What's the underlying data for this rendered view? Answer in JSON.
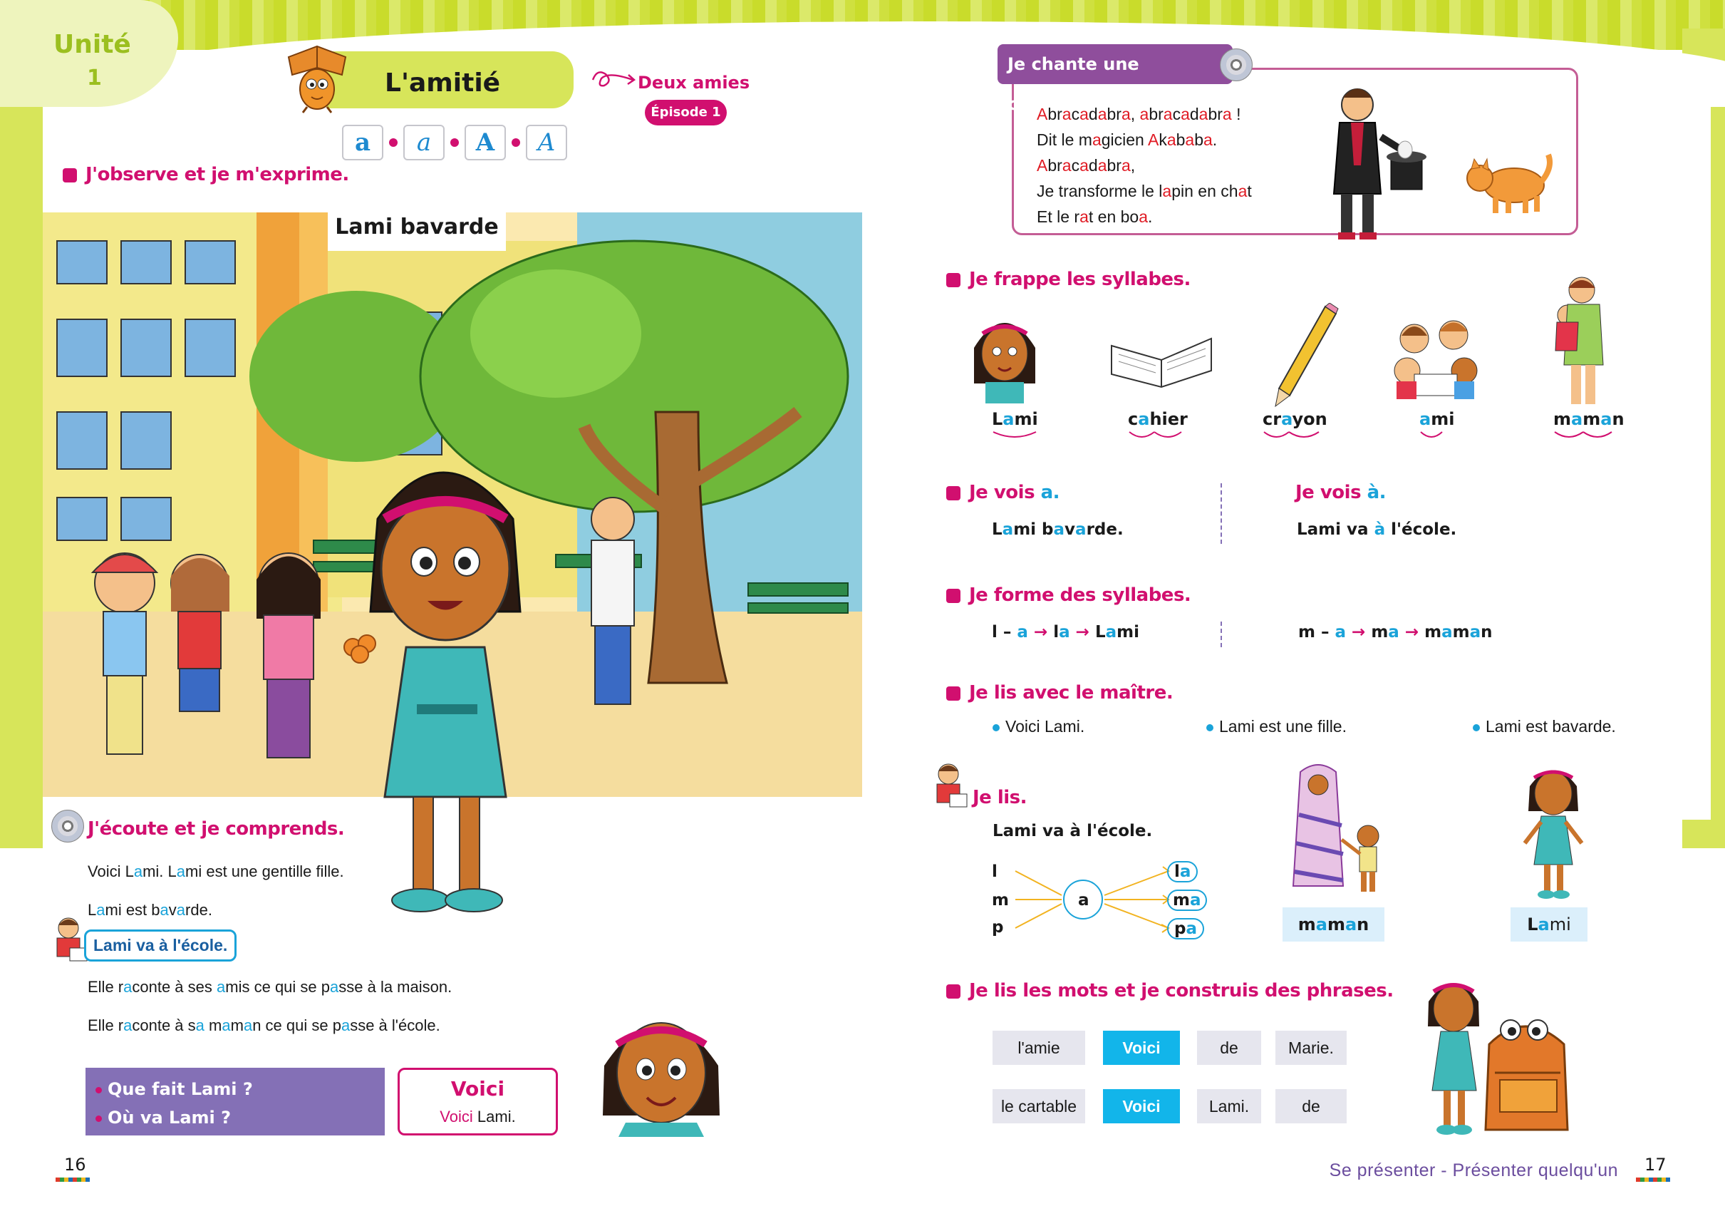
{
  "unit": {
    "label": "Unité",
    "number": "1"
  },
  "title": "L'amitié",
  "story": {
    "name": "Deux amies",
    "episode": "Épisode 1"
  },
  "letters": [
    "a",
    "a",
    "A",
    "A"
  ],
  "left_page": {
    "observe_title": "J'observe et je m'exprime.",
    "illustration_caption": "Lami bavarde",
    "listen_title": "J'écoute et je comprends.",
    "story_lines": {
      "l1": [
        "Voici L",
        "a",
        "mi. L",
        "a",
        "mi est une gentille fille."
      ],
      "l2": [
        "L",
        "a",
        "mi est b",
        "a",
        "v",
        "a",
        "rde."
      ],
      "l3": "Lami va à l'école.",
      "l4": [
        "Elle r",
        "a",
        "conte à ses ",
        "a",
        "mis ce qui se p",
        "a",
        "sse à la maison."
      ],
      "l5": [
        "Elle r",
        "a",
        "conte à s",
        "a",
        " m",
        "a",
        "m",
        "a",
        "n ce qui se p",
        "a",
        "sse à l'école."
      ]
    },
    "questions": [
      "Que fait Lami ?",
      "Où va Lami ?"
    ],
    "voici_box": {
      "title": "Voici",
      "example_word": "Voici",
      "example_rest": " Lami."
    },
    "page_number": "16"
  },
  "right_page": {
    "song": {
      "title": "Je chante une comptine",
      "lines": {
        "l1": [
          [
            "A",
            "r"
          ],
          [
            "br",
            "n"
          ],
          [
            "a",
            "r"
          ],
          [
            "c",
            "n"
          ],
          [
            "a",
            "r"
          ],
          [
            "d",
            "n"
          ],
          [
            "a",
            "r"
          ],
          [
            "br",
            "n"
          ],
          [
            "a",
            "r"
          ],
          [
            ", ",
            "n"
          ],
          [
            "a",
            "r"
          ],
          [
            "br",
            "n"
          ],
          [
            "a",
            "r"
          ],
          [
            "c",
            "n"
          ],
          [
            "a",
            "r"
          ],
          [
            "d",
            "n"
          ],
          [
            "a",
            "r"
          ],
          [
            "br",
            "n"
          ],
          [
            "a",
            "r"
          ],
          [
            " !",
            "n"
          ]
        ],
        "l2": [
          [
            "Dit le m",
            "n"
          ],
          [
            "a",
            "r"
          ],
          [
            "gicien ",
            "n"
          ],
          [
            "A",
            "r"
          ],
          [
            "k",
            "n"
          ],
          [
            "a",
            "r"
          ],
          [
            "b",
            "n"
          ],
          [
            "a",
            "r"
          ],
          [
            "b",
            "n"
          ],
          [
            "a",
            "r"
          ],
          [
            ".",
            "n"
          ]
        ],
        "l3": [
          [
            "A",
            "r"
          ],
          [
            "br",
            "n"
          ],
          [
            "a",
            "r"
          ],
          [
            "c",
            "n"
          ],
          [
            "a",
            "r"
          ],
          [
            "d",
            "n"
          ],
          [
            "a",
            "r"
          ],
          [
            "br",
            "n"
          ],
          [
            "a",
            "r"
          ],
          [
            ",",
            "n"
          ]
        ],
        "l4": [
          [
            "Je transforme le l",
            "n"
          ],
          [
            "a",
            "r"
          ],
          [
            "pin en ch",
            "n"
          ],
          [
            "a",
            "r"
          ],
          [
            "t",
            "n"
          ]
        ],
        "l5": [
          [
            "Et le r",
            "n"
          ],
          [
            "a",
            "r"
          ],
          [
            "t en bo",
            "n"
          ],
          [
            "a",
            "r"
          ],
          [
            ".",
            "n"
          ]
        ]
      }
    },
    "syllables": {
      "title": "Je frappe les syllabes.",
      "words": [
        {
          "pre": "L",
          "a": "a",
          "post": "mi"
        },
        {
          "pre": "c",
          "a": "a",
          "post": "hier"
        },
        {
          "pre": "cr",
          "a": "a",
          "post": "yon"
        },
        {
          "pre": "",
          "a": "a",
          "post": "mi"
        },
        {
          "pre": "m",
          "a": "a",
          "post": "m",
          "a2": "a",
          "post2": "n"
        }
      ]
    },
    "see": {
      "title_a": "Je vois ",
      "title_a_letter": "a.",
      "title_a_grave": "Je vois ",
      "title_a_grave_letter": "à.",
      "ex_a": [
        "L",
        "a",
        "mi b",
        "a",
        "v",
        "a",
        "rde."
      ],
      "ex_a_grave": [
        "Lami va ",
        "à",
        " l'école."
      ]
    },
    "form": {
      "title": "Je forme des syllabes.",
      "left": [
        "l – ",
        "a",
        " → ",
        "l",
        "a",
        " → ",
        "L",
        "a",
        "mi"
      ],
      "right": [
        "m – ",
        "a",
        " → ",
        "m",
        "a",
        " → ",
        "m",
        "a",
        "m",
        "a",
        "n"
      ]
    },
    "read_master": {
      "title": "Je lis avec le maître.",
      "items": [
        "Voici Lami.",
        "Lami est une fille.",
        "Lami est bavarde."
      ]
    },
    "read": {
      "title": "Je lis.",
      "sentence": "Lami va à l'école.",
      "consonants": [
        "l",
        "m",
        "p"
      ],
      "vowel": "a",
      "results": [
        [
          "l",
          "a"
        ],
        [
          "m",
          "a"
        ],
        [
          "p",
          "a"
        ]
      ],
      "word_tags": [
        {
          "pre": "m",
          "a": "a",
          "mid": "m",
          "a2": "a",
          "post": "n"
        },
        {
          "pre": "L",
          "a": "a",
          "mid": "mi",
          "a2": "",
          "post": ""
        }
      ]
    },
    "build": {
      "title": "Je lis les mots et je construis des phrases.",
      "row1": [
        "l'amie",
        "Voici",
        "de",
        "Marie."
      ],
      "row2": [
        "le cartable",
        "Voici",
        "Lami.",
        "de"
      ]
    },
    "footer_theme": "Se présenter - Présenter quelqu'un",
    "page_number": "17"
  }
}
